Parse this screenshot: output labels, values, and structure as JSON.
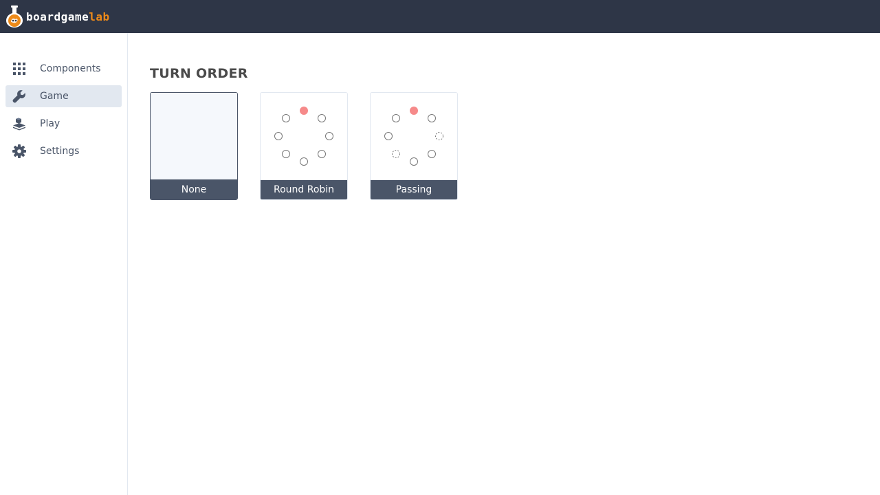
{
  "app": {
    "logo_text_main": "boardgame",
    "logo_text_accent": "lab",
    "accent_color": "#ed8a19",
    "topbar_color": "#2e3647"
  },
  "sidebar": {
    "items": [
      {
        "label": "Components",
        "icon": "grid-icon",
        "active": false
      },
      {
        "label": "Game",
        "icon": "wrench-icon",
        "active": true
      },
      {
        "label": "Play",
        "icon": "layers-icon",
        "active": false
      },
      {
        "label": "Settings",
        "icon": "gear-icon",
        "active": false
      }
    ]
  },
  "main": {
    "section_title": "TURN ORDER",
    "options": [
      {
        "label": "None",
        "selected": true
      },
      {
        "label": "Round Robin",
        "selected": false
      },
      {
        "label": "Passing",
        "selected": false
      }
    ],
    "player_color": "#f68a8a"
  }
}
